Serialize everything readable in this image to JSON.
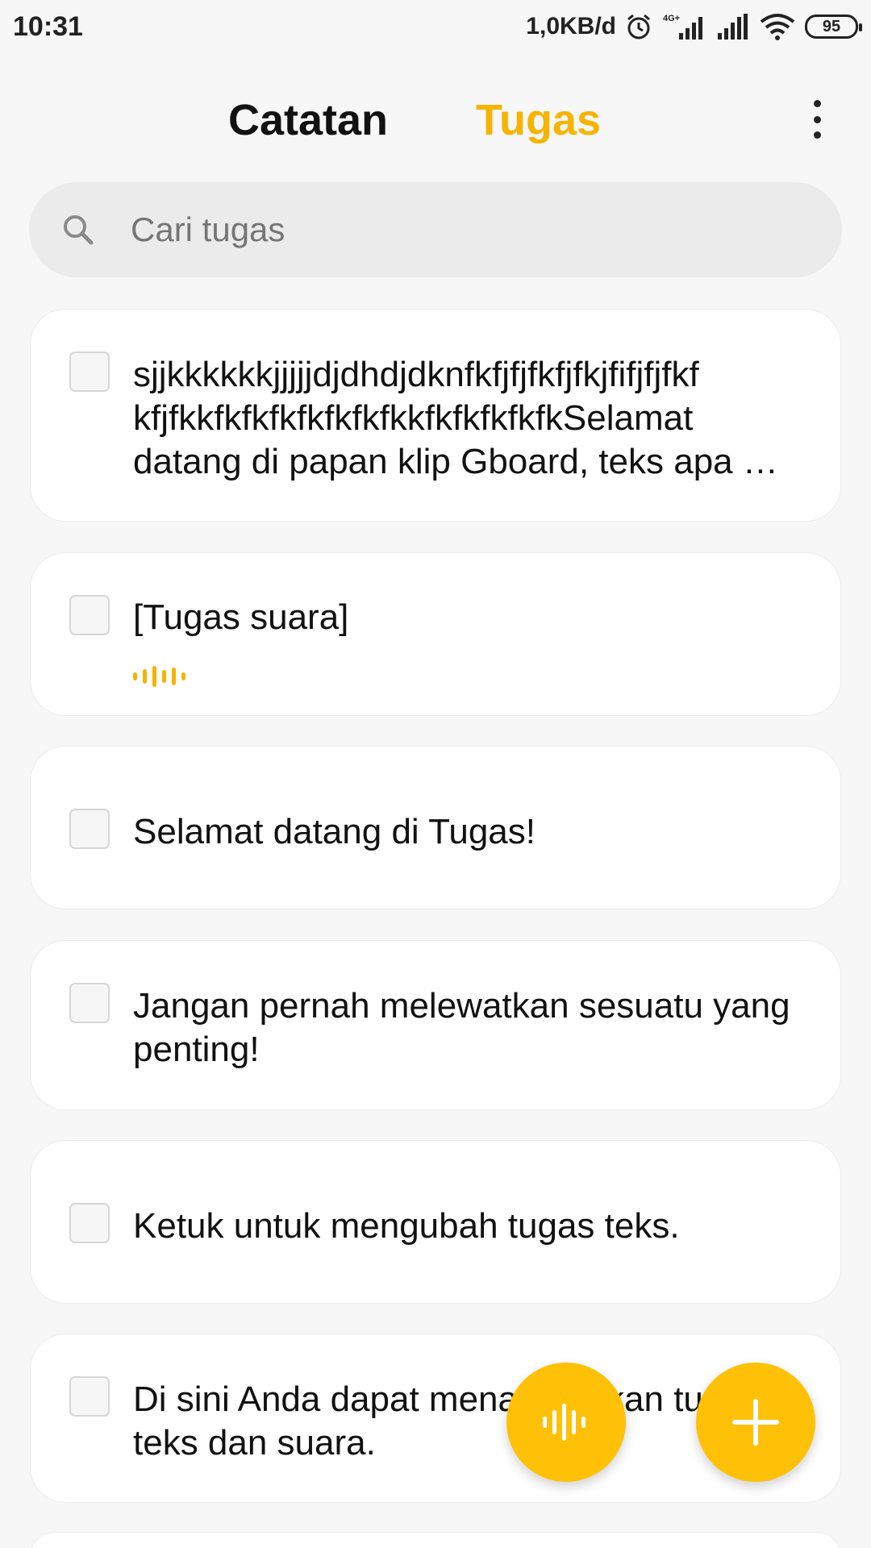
{
  "status_bar": {
    "time": "10:31",
    "network_speed": "1,0KB/d",
    "network_type": "4G+",
    "battery": "95",
    "icons": [
      "alarm-icon",
      "signal-icon",
      "signal-icon",
      "wifi-icon"
    ]
  },
  "header": {
    "tab_notes": "Catatan",
    "tab_tasks": "Tugas",
    "more_icon": "more-vert-icon"
  },
  "search": {
    "placeholder": "Cari tugas",
    "icon": "search-icon"
  },
  "tasks": [
    {
      "text": "sjjkkkkkkjjjjjdjdhdjdknfkfjfjfkfjfkjfifjfjfkf kfjfkkfkfkfkfkfkfkfkkfkfkfkfkfkSelamat datang di papan klip Gboard, teks apa …",
      "checked": false
    },
    {
      "text": "[Tugas suara]",
      "checked": false,
      "voice": true
    },
    {
      "text": "Selamat datang di Tugas!",
      "checked": false
    },
    {
      "text": "Jangan pernah melewatkan sesuatu yang penting!",
      "checked": false
    },
    {
      "text": "Ketuk untuk mengubah tugas teks.",
      "checked": false
    },
    {
      "text": "Di sini Anda dapat menambahkan tugas teks dan suara.",
      "checked": false
    }
  ],
  "fabs": {
    "voice_icon": "voice-wave-icon",
    "add_icon": "plus-icon"
  },
  "colors": {
    "accent": "#f5b400",
    "fab": "#ffc107",
    "background": "#f7f7f7",
    "card": "#ffffff"
  }
}
